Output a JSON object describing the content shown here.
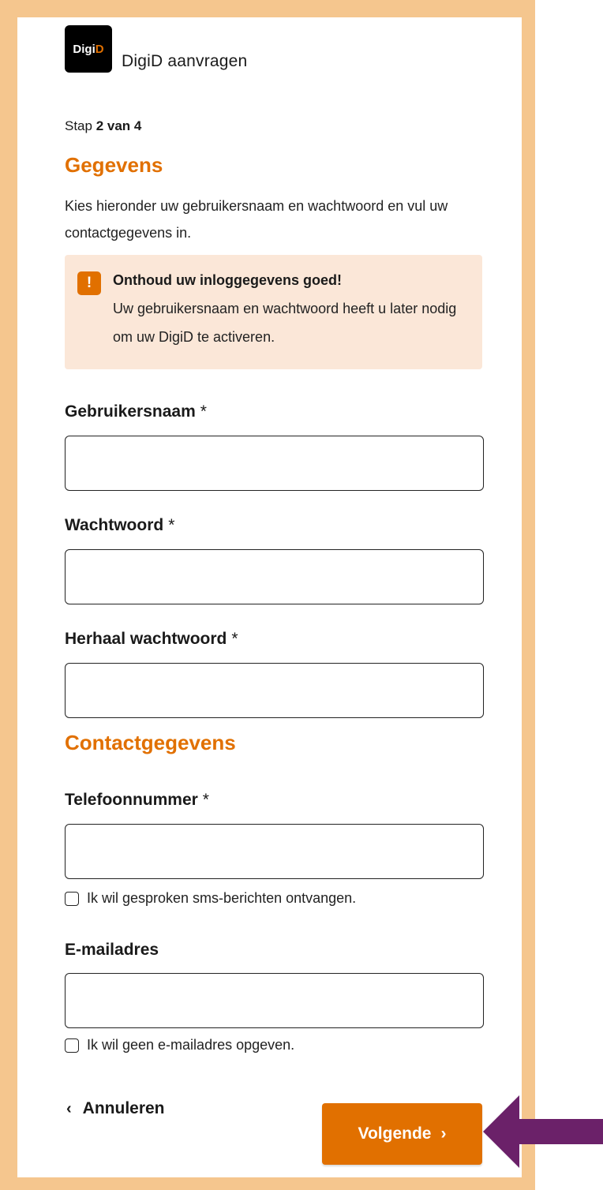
{
  "header": {
    "logo_text_main": "Digi",
    "logo_text_accent": "D",
    "app_title": "DigiD aanvragen"
  },
  "step": {
    "prefix": "Stap",
    "value": "2 van 4"
  },
  "section_gegevens": {
    "heading": "Gegevens",
    "intro": "Kies hieronder uw gebruikersnaam en wachtwoord en vul uw contactgegevens in."
  },
  "notice": {
    "icon": "!",
    "title": "Onthoud uw inloggegevens goed!",
    "body": "Uw gebruikersnaam en wachtwoord heeft u later nodig om uw DigiD te activeren."
  },
  "fields": {
    "username_label": "Gebruikersnaam",
    "password_label": "Wachtwoord",
    "repeat_password_label": "Herhaal wachtwoord",
    "required_marker": "*",
    "phone_label": "Telefoonnummer",
    "email_label": "E-mailadres",
    "username_value": "",
    "password_value": "",
    "repeat_password_value": "",
    "phone_value": "",
    "email_value": ""
  },
  "section_contact": {
    "heading": "Contactgegevens"
  },
  "checkboxes": {
    "spoken_sms": "Ik wil gesproken sms-berichten ontvangen.",
    "no_email": "Ik wil geen e-mailadres opgeven."
  },
  "actions": {
    "cancel_label": "Annuleren",
    "cancel_icon": "‹",
    "next_label": "Volgende",
    "next_icon": "›"
  },
  "colors": {
    "accent": "#e17000",
    "frame": "#f5c68e",
    "notice_bg": "#fbe7d8",
    "arrow": "#6b2169"
  }
}
